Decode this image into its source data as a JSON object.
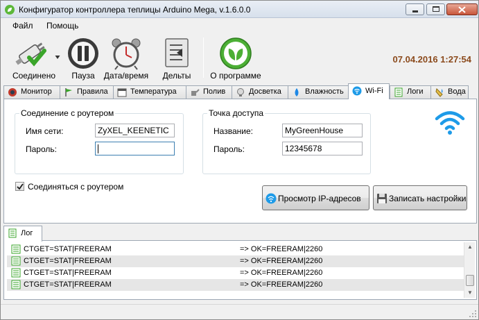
{
  "window": {
    "title": "Конфигуратор контроллера теплицы Arduino Mega, v.1.6.0.0",
    "icon": "app-plant-icon"
  },
  "menu": {
    "file": "Файл",
    "help": "Помощь"
  },
  "toolbar": {
    "connected": "Соединено",
    "pause": "Пауза",
    "datetime": "Дата/время",
    "deltas": "Дельты",
    "about": "О программе",
    "clock": "07.04.2016 1:27:54"
  },
  "tabs": [
    {
      "label": "Монитор",
      "icon": "monitor-icon"
    },
    {
      "label": "Правила",
      "icon": "flag-icon"
    },
    {
      "label": "Температура",
      "icon": "calendar-icon"
    },
    {
      "label": "Полив",
      "icon": "watering-icon"
    },
    {
      "label": "Досветка",
      "icon": "bulb-icon"
    },
    {
      "label": "Влажность",
      "icon": "drop-icon"
    },
    {
      "label": "Wi-Fi",
      "icon": "wifi-icon"
    },
    {
      "label": "Логи",
      "icon": "log-icon"
    },
    {
      "label": "Вода",
      "icon": "water-icon"
    }
  ],
  "wifi": {
    "router_group": "Соединение с роутером",
    "ssid_label": "Имя сети:",
    "ssid_value": "ZyXEL_KEENETIC",
    "password_label": "Пароль:",
    "password_value": "",
    "ap_group": "Точка доступа",
    "ap_name_label": "Название:",
    "ap_name_value": "MyGreenHouse",
    "ap_password_label": "Пароль:",
    "ap_password_value": "12345678",
    "connect_checkbox": "Соединяться с роутером",
    "connect_checked": true,
    "view_ip_button": "Просмотр IP-адресов",
    "save_button": "Записать настройки"
  },
  "log": {
    "tab_label": "Лог",
    "rows": [
      {
        "cmd": "CTGET=STAT|FREERAM",
        "resp": "=> OK=FREERAM|2260"
      },
      {
        "cmd": "CTGET=STAT|FREERAM",
        "resp": "=> OK=FREERAM|2260"
      },
      {
        "cmd": "CTGET=STAT|FREERAM",
        "resp": "=> OK=FREERAM|2260"
      },
      {
        "cmd": "CTGET=STAT|FREERAM",
        "resp": "=> OK=FREERAM|2260"
      }
    ]
  },
  "colors": {
    "clock": "#8b4a1c",
    "wifi_blue": "#1e9be8",
    "about_green": "#4caf35"
  }
}
